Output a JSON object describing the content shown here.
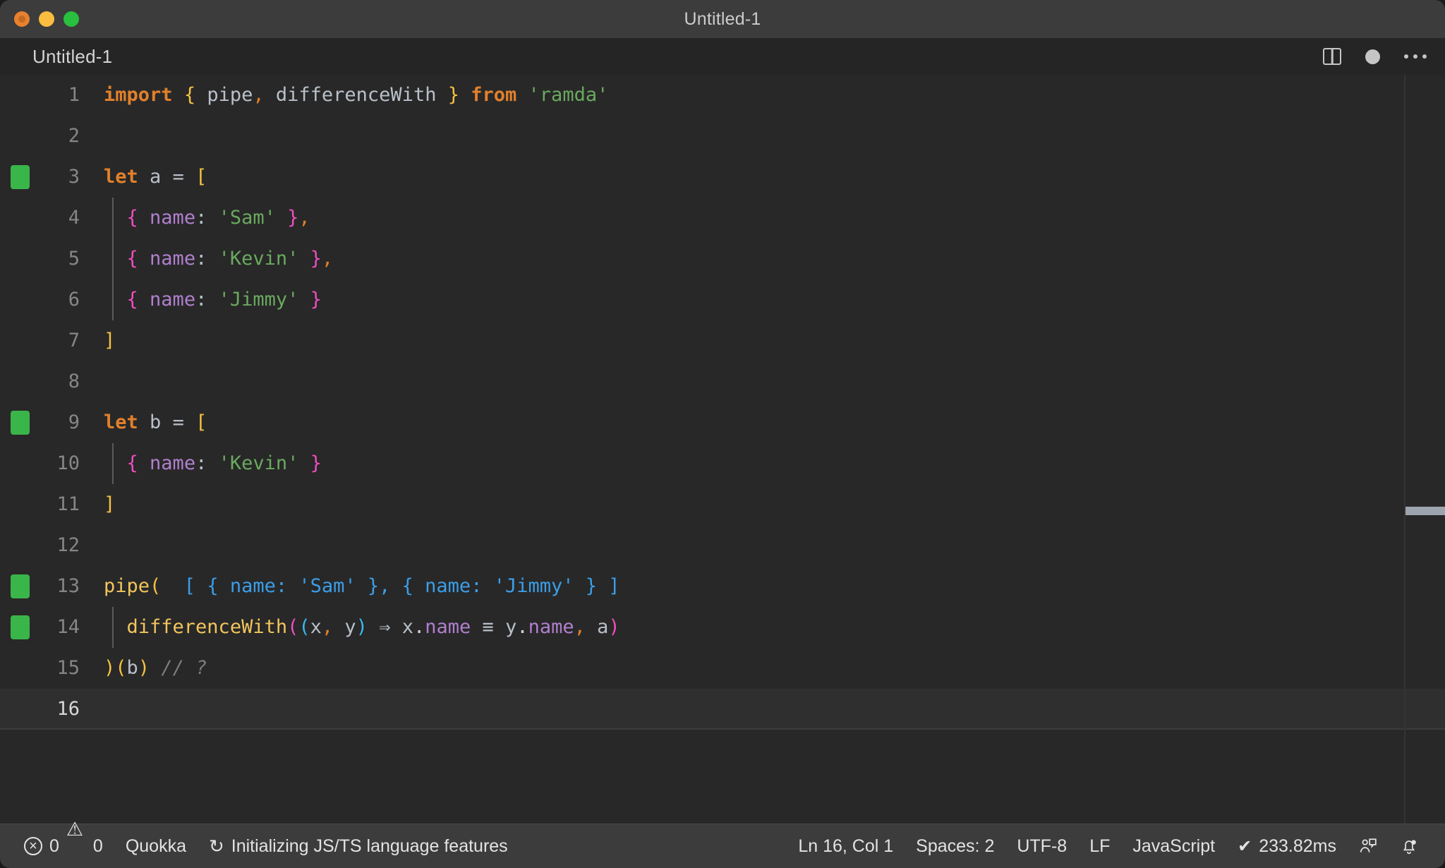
{
  "window": {
    "title": "Untitled-1",
    "traffic_lights": [
      {
        "name": "close",
        "color": "#e8812e"
      },
      {
        "name": "minimize",
        "color": "#f9bd3f"
      },
      {
        "name": "maximize",
        "color": "#28c03e"
      }
    ]
  },
  "tab": {
    "label": "Untitled-1",
    "actions": [
      {
        "name": "split-editor",
        "icon": "split-editor-icon"
      },
      {
        "name": "unsaved-indicator",
        "icon": "dirty-dot-icon"
      },
      {
        "name": "more-actions",
        "icon": "ellipsis-icon"
      }
    ]
  },
  "editor": {
    "language": "JavaScript",
    "lines": [
      {
        "number": "1",
        "marker": false,
        "active": false,
        "indent_guide": false,
        "tokens": [
          {
            "text": "import",
            "cls": "t-kw"
          },
          {
            "text": " ",
            "cls": "t-plain"
          },
          {
            "text": "{",
            "cls": "t-br1"
          },
          {
            "text": " pipe",
            "cls": "t-plain"
          },
          {
            "text": ",",
            "cls": "t-comma"
          },
          {
            "text": " differenceWith ",
            "cls": "t-plain"
          },
          {
            "text": "}",
            "cls": "t-br1"
          },
          {
            "text": " ",
            "cls": "t-plain"
          },
          {
            "text": "from",
            "cls": "t-kw"
          },
          {
            "text": " ",
            "cls": "t-plain"
          },
          {
            "text": "'ramda'",
            "cls": "t-str"
          }
        ]
      },
      {
        "number": "2",
        "marker": false,
        "active": false,
        "indent_guide": false,
        "tokens": []
      },
      {
        "number": "3",
        "marker": true,
        "active": false,
        "indent_guide": false,
        "tokens": [
          {
            "text": "let",
            "cls": "t-kw"
          },
          {
            "text": " a ",
            "cls": "t-plain"
          },
          {
            "text": "=",
            "cls": "t-op"
          },
          {
            "text": " ",
            "cls": "t-plain"
          },
          {
            "text": "[",
            "cls": "t-br1"
          }
        ]
      },
      {
        "number": "4",
        "marker": false,
        "active": false,
        "indent_guide": true,
        "tokens": [
          {
            "text": "  ",
            "cls": "t-plain"
          },
          {
            "text": "{",
            "cls": "t-br2"
          },
          {
            "text": " ",
            "cls": "t-plain"
          },
          {
            "text": "name",
            "cls": "t-prop"
          },
          {
            "text": ": ",
            "cls": "t-plain"
          },
          {
            "text": "'Sam'",
            "cls": "t-str"
          },
          {
            "text": " ",
            "cls": "t-plain"
          },
          {
            "text": "}",
            "cls": "t-br2"
          },
          {
            "text": ",",
            "cls": "t-comma"
          }
        ]
      },
      {
        "number": "5",
        "marker": false,
        "active": false,
        "indent_guide": true,
        "tokens": [
          {
            "text": "  ",
            "cls": "t-plain"
          },
          {
            "text": "{",
            "cls": "t-br2"
          },
          {
            "text": " ",
            "cls": "t-plain"
          },
          {
            "text": "name",
            "cls": "t-prop"
          },
          {
            "text": ": ",
            "cls": "t-plain"
          },
          {
            "text": "'Kevin'",
            "cls": "t-str"
          },
          {
            "text": " ",
            "cls": "t-plain"
          },
          {
            "text": "}",
            "cls": "t-br2"
          },
          {
            "text": ",",
            "cls": "t-comma"
          }
        ]
      },
      {
        "number": "6",
        "marker": false,
        "active": false,
        "indent_guide": true,
        "tokens": [
          {
            "text": "  ",
            "cls": "t-plain"
          },
          {
            "text": "{",
            "cls": "t-br2"
          },
          {
            "text": " ",
            "cls": "t-plain"
          },
          {
            "text": "name",
            "cls": "t-prop"
          },
          {
            "text": ": ",
            "cls": "t-plain"
          },
          {
            "text": "'Jimmy'",
            "cls": "t-str"
          },
          {
            "text": " ",
            "cls": "t-plain"
          },
          {
            "text": "}",
            "cls": "t-br2"
          }
        ]
      },
      {
        "number": "7",
        "marker": false,
        "active": false,
        "indent_guide": false,
        "tokens": [
          {
            "text": "]",
            "cls": "t-br1"
          }
        ]
      },
      {
        "number": "8",
        "marker": false,
        "active": false,
        "indent_guide": false,
        "tokens": []
      },
      {
        "number": "9",
        "marker": true,
        "active": false,
        "indent_guide": false,
        "tokens": [
          {
            "text": "let",
            "cls": "t-kw"
          },
          {
            "text": " b ",
            "cls": "t-plain"
          },
          {
            "text": "=",
            "cls": "t-op"
          },
          {
            "text": " ",
            "cls": "t-plain"
          },
          {
            "text": "[",
            "cls": "t-br1"
          }
        ]
      },
      {
        "number": "10",
        "marker": false,
        "active": false,
        "indent_guide": true,
        "tokens": [
          {
            "text": "  ",
            "cls": "t-plain"
          },
          {
            "text": "{",
            "cls": "t-br2"
          },
          {
            "text": " ",
            "cls": "t-plain"
          },
          {
            "text": "name",
            "cls": "t-prop"
          },
          {
            "text": ": ",
            "cls": "t-plain"
          },
          {
            "text": "'Kevin'",
            "cls": "t-str"
          },
          {
            "text": " ",
            "cls": "t-plain"
          },
          {
            "text": "}",
            "cls": "t-br2"
          }
        ]
      },
      {
        "number": "11",
        "marker": false,
        "active": false,
        "indent_guide": false,
        "tokens": [
          {
            "text": "]",
            "cls": "t-br1"
          }
        ]
      },
      {
        "number": "12",
        "marker": false,
        "active": false,
        "indent_guide": false,
        "tokens": []
      },
      {
        "number": "13",
        "marker": true,
        "active": false,
        "indent_guide": false,
        "tokens": [
          {
            "text": "pipe",
            "cls": "t-fn"
          },
          {
            "text": "(",
            "cls": "t-br1"
          },
          {
            "text": "  [ { name: 'Sam' }, { name: 'Jimmy' } ]",
            "cls": "t-inline"
          }
        ]
      },
      {
        "number": "14",
        "marker": true,
        "active": false,
        "indent_guide": true,
        "tokens": [
          {
            "text": "  ",
            "cls": "t-plain"
          },
          {
            "text": "differenceWith",
            "cls": "t-fn"
          },
          {
            "text": "(",
            "cls": "t-br2"
          },
          {
            "text": "(",
            "cls": "t-br3"
          },
          {
            "text": "x",
            "cls": "t-plain"
          },
          {
            "text": ",",
            "cls": "t-comma"
          },
          {
            "text": " y",
            "cls": "t-plain"
          },
          {
            "text": ")",
            "cls": "t-br3"
          },
          {
            "text": " ⇒ ",
            "cls": "t-op"
          },
          {
            "text": "x",
            "cls": "t-plain"
          },
          {
            "text": ".",
            "cls": "t-punc"
          },
          {
            "text": "name",
            "cls": "t-prop"
          },
          {
            "text": " ≡ ",
            "cls": "t-op"
          },
          {
            "text": "y",
            "cls": "t-plain"
          },
          {
            "text": ".",
            "cls": "t-punc"
          },
          {
            "text": "name",
            "cls": "t-prop"
          },
          {
            "text": ",",
            "cls": "t-comma"
          },
          {
            "text": " a",
            "cls": "t-plain"
          },
          {
            "text": ")",
            "cls": "t-br2"
          }
        ]
      },
      {
        "number": "15",
        "marker": false,
        "active": false,
        "indent_guide": false,
        "tokens": [
          {
            "text": ")",
            "cls": "t-br1"
          },
          {
            "text": "(",
            "cls": "t-br1"
          },
          {
            "text": "b",
            "cls": "t-plain"
          },
          {
            "text": ")",
            "cls": "t-br1"
          },
          {
            "text": " ",
            "cls": "t-plain"
          },
          {
            "text": "// ?",
            "cls": "t-comment"
          }
        ]
      },
      {
        "number": "16",
        "marker": false,
        "active": true,
        "indent_guide": false,
        "tokens": []
      }
    ]
  },
  "statusbar": {
    "errors": "0",
    "warnings": "0",
    "quokka": "Quokka",
    "task": "Initializing JS/TS language features",
    "cursor": "Ln 16, Col 1",
    "indentation": "Spaces: 2",
    "encoding": "UTF-8",
    "eol": "LF",
    "language": "JavaScript",
    "runtime": "233.82ms",
    "icons": {
      "error": "error-icon",
      "warning": "warning-icon",
      "sync": "sync-icon",
      "check": "check-icon",
      "feedback": "feedback-person-icon",
      "bell": "notifications-bell-icon"
    }
  }
}
